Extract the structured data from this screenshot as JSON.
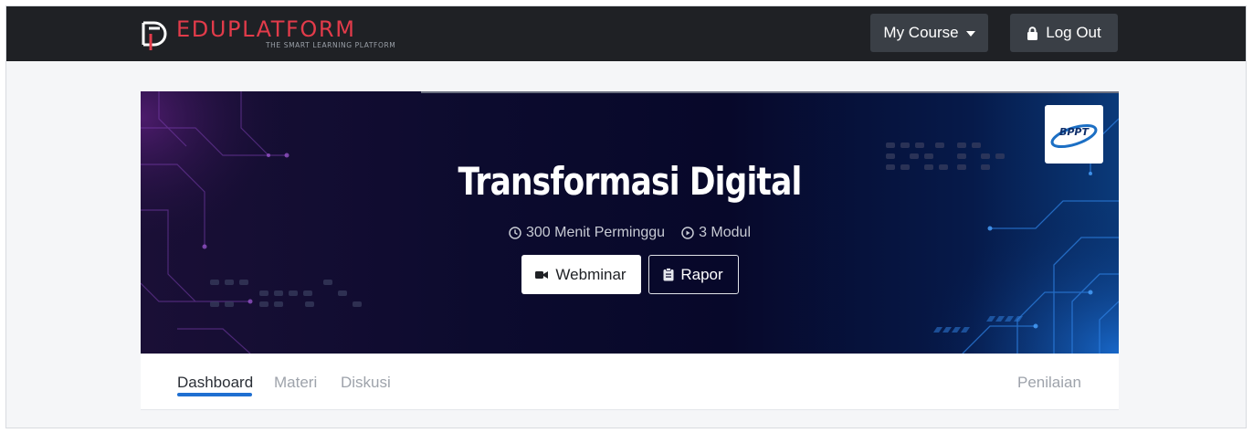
{
  "navbar": {
    "logo_word": "EDUPLATFORM",
    "logo_tagline": "THE SMART LEARNING PLATFORM",
    "my_course_label": "My Course",
    "logout_label": "Log Out",
    "icons": {
      "course_caret": "caret-down-icon",
      "logout": "lock-icon"
    }
  },
  "course": {
    "title": "Transformasi Digital",
    "duration": "300 Menit Perminggu",
    "modules": "3 Modul",
    "webminar_label": "Webminar",
    "rapor_label": "Rapor",
    "org_logo_text": "BPPT",
    "icons": {
      "duration": "clock-icon",
      "modules": "play-circle-icon",
      "webminar": "video-camera-icon",
      "rapor": "clipboard-icon"
    }
  },
  "tabs": {
    "items": [
      {
        "label": "Dashboard",
        "active": true
      },
      {
        "label": "Materi",
        "active": false
      },
      {
        "label": "Diskusi",
        "active": false
      }
    ],
    "right_label": "Penilaian"
  },
  "colors": {
    "navbar_bg": "#1f2125",
    "logo_red": "#e23b4a",
    "nav_button_bg": "#3a3f46",
    "tab_active_underline": "#1f6fd1",
    "banner_dark": "#07082a",
    "banner_blue": "#0a3a7a"
  }
}
